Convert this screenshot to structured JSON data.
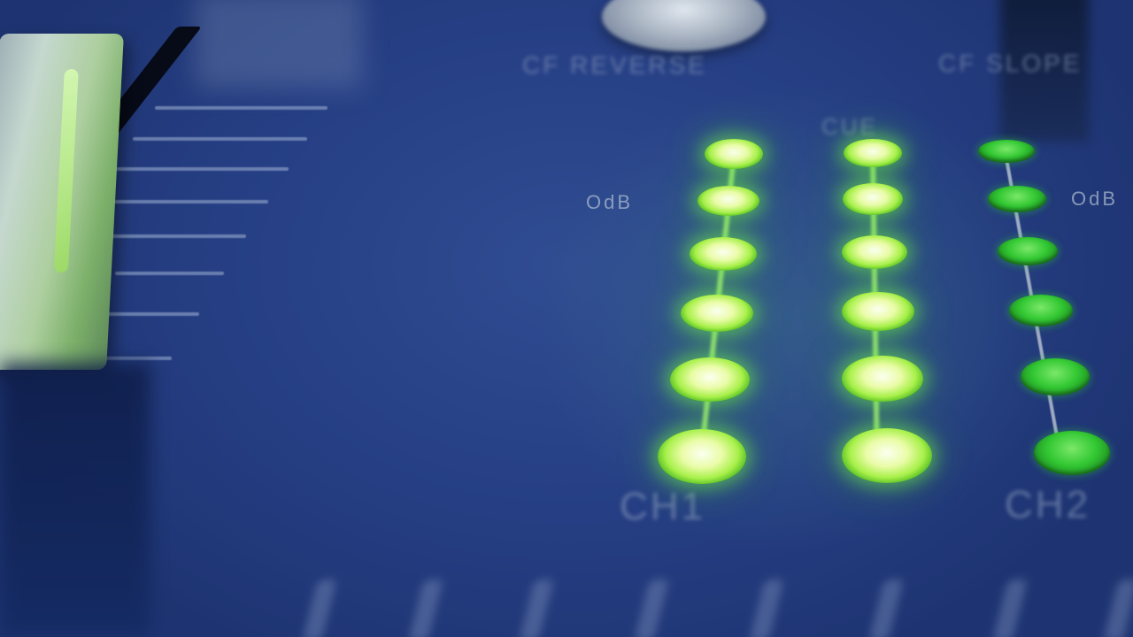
{
  "panel": {
    "labels": {
      "left_meter_db": "OdB",
      "right_meter_db": "OdB",
      "cue": "CUE",
      "channel_1": "CH1",
      "channel_2": "CH2",
      "top_left": "CF REVERSE",
      "top_right": "CF SLOPE"
    },
    "colors": {
      "panel": "#243a7c",
      "led_lit": "#b8ff5a",
      "led_dim": "#33c833",
      "silkscreen": "#aab9cd"
    },
    "meters": [
      {
        "name": "ch1-meter",
        "leds_lit": 6,
        "leds_total": 6
      },
      {
        "name": "cue-meter",
        "leds_lit": 6,
        "leds_total": 6
      },
      {
        "name": "ch2-meter",
        "leds_lit": 0,
        "leds_total": 6
      }
    ]
  }
}
